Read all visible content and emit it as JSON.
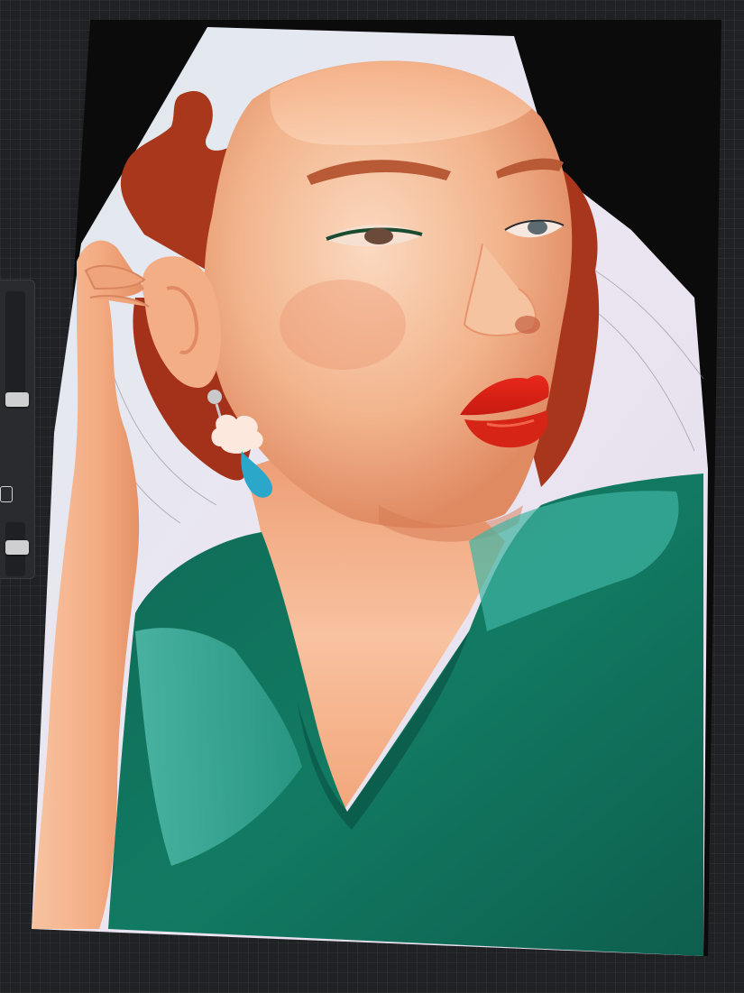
{
  "app": {
    "canvas": {
      "subject": "digital-portrait-painting",
      "colors": {
        "background": "#e4e0ec",
        "hair": "#a8371c",
        "skin": "#f2b48c",
        "lips": "#d8201a",
        "shirt": "#11725e",
        "shirt_highlight": "#34b5a3",
        "earring_drop": "#2aa7c9"
      }
    },
    "sidebar": {
      "brush_size_icon": "brush-size-slider",
      "modify_icon": "square-outline-icon",
      "opacity_icon": "opacity-slider"
    }
  }
}
